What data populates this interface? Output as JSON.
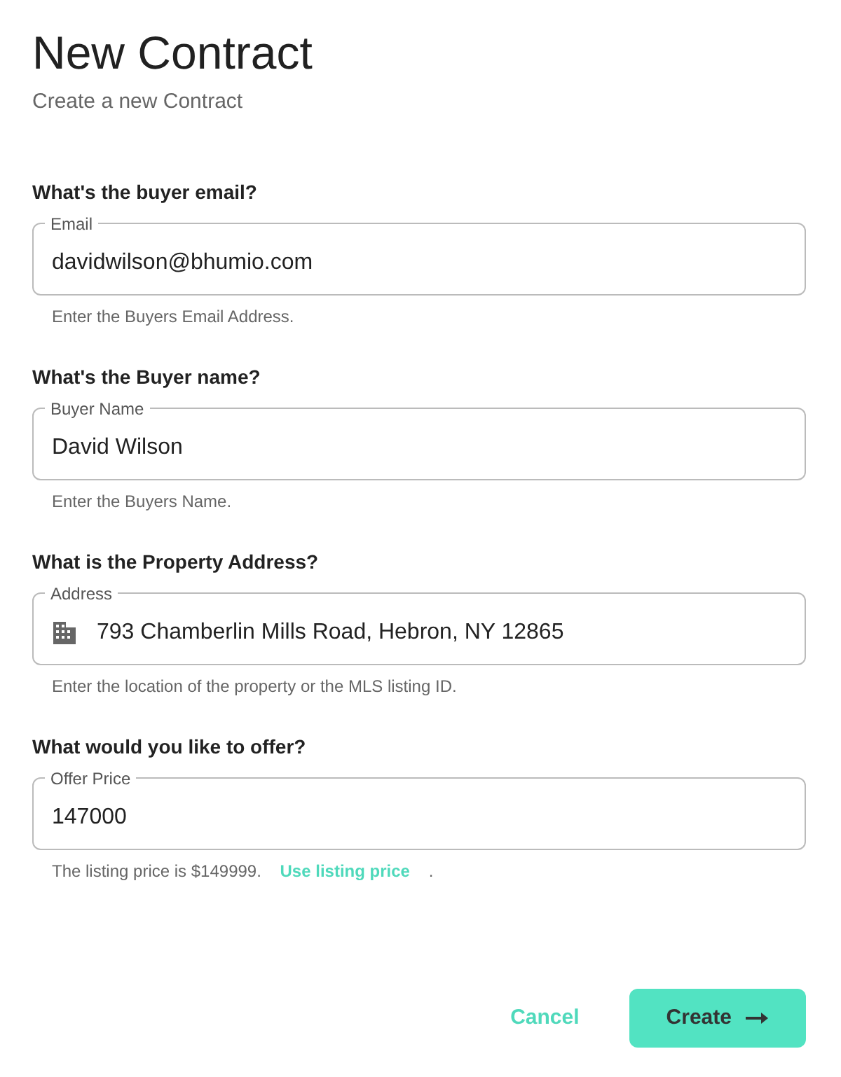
{
  "title": "New Contract",
  "subtitle": "Create a new Contract",
  "fields": [
    {
      "question": "What's the buyer email?",
      "label": "Email",
      "value": "davidwilson@bhumio.com",
      "kind": "text",
      "helper": [
        {
          "kind": "text",
          "text": "Enter the Buyers Email Address."
        }
      ]
    },
    {
      "question": "What's the Buyer name?",
      "label": "Buyer Name",
      "value": "David Wilson",
      "kind": "text",
      "helper": [
        {
          "kind": "text",
          "text": "Enter the Buyers Name."
        }
      ]
    },
    {
      "question": "What is the Property Address?",
      "label": "Address",
      "value": "793 Chamberlin Mills Road, Hebron, NY 12865",
      "kind": "address",
      "helper": [
        {
          "kind": "text",
          "text": "Enter the location of the property or the MLS listing ID."
        }
      ]
    },
    {
      "question": "What would you like to offer?",
      "label": "Offer Price",
      "value": "147000",
      "kind": "text",
      "helper": [
        {
          "kind": "text",
          "text": "The listing price is $149999."
        },
        {
          "kind": "link",
          "text": "Use listing price"
        },
        {
          "kind": "text",
          "text": "."
        }
      ]
    }
  ],
  "buttons": [
    {
      "label": "Cancel",
      "kind": "text"
    },
    {
      "label": "Create",
      "kind": "primary"
    }
  ]
}
